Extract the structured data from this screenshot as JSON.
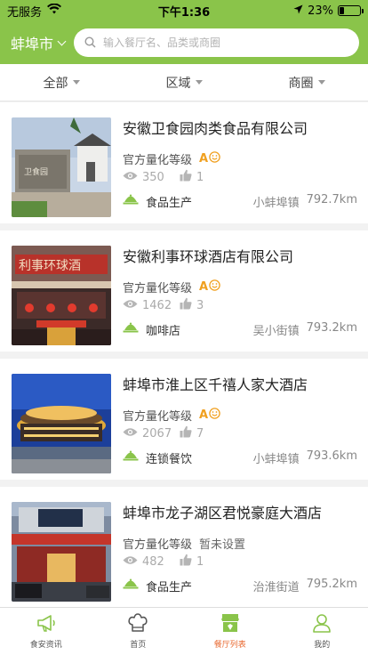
{
  "status_bar": {
    "carrier": "无服务",
    "time": "下午1:36",
    "battery_text": "23%",
    "battery_level": 0.23
  },
  "header": {
    "city": "蚌埠市",
    "search_placeholder": "输入餐厅名、品类或商圈"
  },
  "filters": [
    {
      "label": "全部"
    },
    {
      "label": "区域"
    },
    {
      "label": "商圈"
    }
  ],
  "colors": {
    "brand_green": "#8ac44a",
    "grade_orange": "#f0a020",
    "active_tab": "#e8672e"
  },
  "restaurants": [
    {
      "name": "安徽卫食园肉类食品有限公司",
      "grade_label": "官方量化等级",
      "grade": "A",
      "grade_icon": "smile-face-icon",
      "grade_text": "",
      "views": "350",
      "likes": "1",
      "category": "食品生产",
      "area": "小蚌埠镇",
      "distance": "792.7km"
    },
    {
      "name": "安徽利事环球酒店有限公司",
      "grade_label": "官方量化等级",
      "grade": "A",
      "grade_icon": "smile-face-icon",
      "grade_text": "",
      "views": "1462",
      "likes": "3",
      "category": "咖啡店",
      "area": "吴小街镇",
      "distance": "793.2km"
    },
    {
      "name": "蚌埠市淮上区千禧人家大酒店",
      "grade_label": "官方量化等级",
      "grade": "A",
      "grade_icon": "smile-face-icon",
      "grade_text": "",
      "views": "2067",
      "likes": "7",
      "category": "连锁餐饮",
      "area": "小蚌埠镇",
      "distance": "793.6km"
    },
    {
      "name": "蚌埠市龙子湖区君悦豪庭大酒店",
      "grade_label": "官方量化等级",
      "grade": "",
      "grade_icon": "",
      "grade_text": "暂未设置",
      "views": "482",
      "likes": "1",
      "category": "食品生产",
      "area": "治淮街道",
      "distance": "795.2km"
    }
  ],
  "tabs": [
    {
      "label": "食安资讯",
      "icon": "megaphone-icon"
    },
    {
      "label": "首页",
      "icon": "chef-hat-icon"
    },
    {
      "label": "餐厅列表",
      "icon": "restaurant-store-icon",
      "active": true
    },
    {
      "label": "我的",
      "icon": "person-icon"
    }
  ]
}
